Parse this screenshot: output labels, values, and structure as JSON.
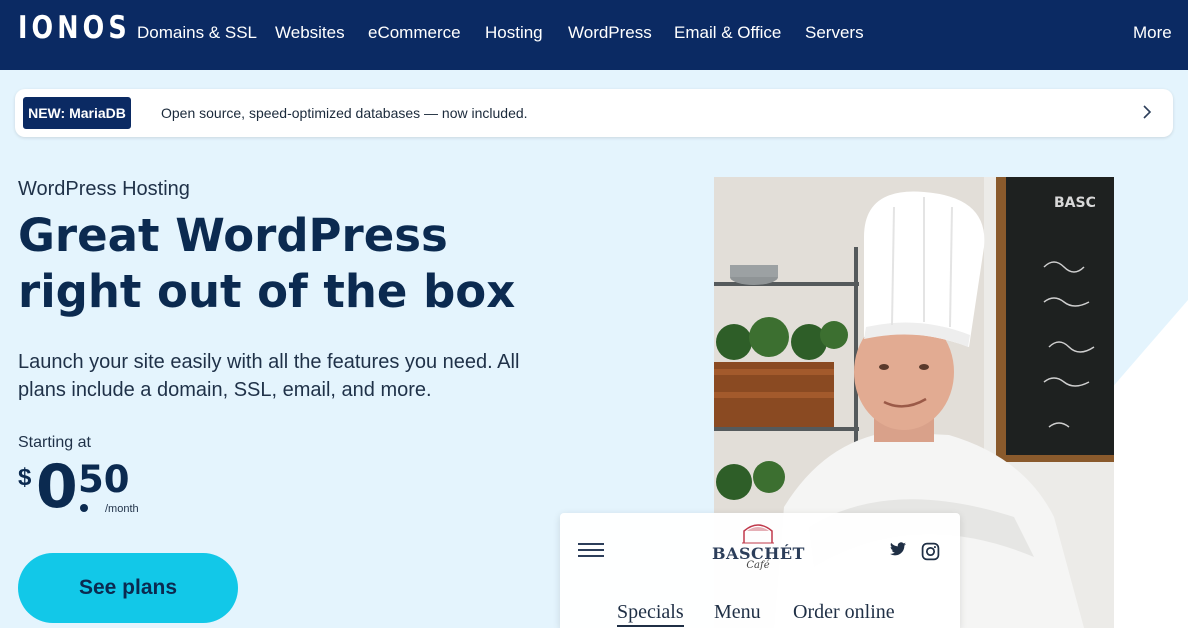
{
  "topnav": {
    "logo": "IONOS",
    "items": [
      "Domains & SSL",
      "Websites",
      "eCommerce",
      "Hosting",
      "WordPress",
      "Email & Office",
      "Servers"
    ],
    "more": "More"
  },
  "announcement": {
    "badge": "NEW: MariaDB",
    "text": "Open source, speed-optimized databases — now included.",
    "icon": "chevron-right-icon"
  },
  "hero": {
    "eyebrow": "WordPress Hosting",
    "headline": "Great WordPress right out of the box",
    "subtext": "Launch your site easily with all the features you need. All plans include a domain, SSL, email, and more.",
    "starting_label": "Starting at",
    "price": {
      "currency": "$",
      "whole": "0",
      "cents": "50",
      "period": "/month"
    },
    "cta": "See plans"
  },
  "mockup": {
    "brand": "BASCHÉT",
    "brand_sub": "Café",
    "nav": [
      "Specials",
      "Menu",
      "Order online"
    ],
    "active_nav": "Specials",
    "icons": [
      "menu-icon",
      "twitter-icon",
      "instagram-icon"
    ]
  },
  "colors": {
    "nav_bg": "#0b2a63",
    "page_bg": "#e4f4fd",
    "cta": "#12c8e8",
    "heading": "#0b2a50"
  }
}
